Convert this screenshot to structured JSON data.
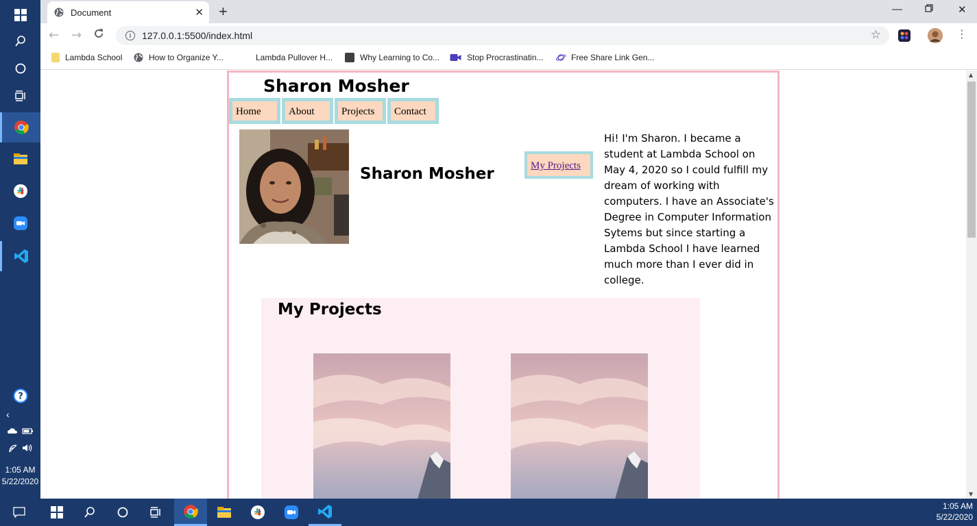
{
  "browser": {
    "tab_title": "Document",
    "new_tab": "+",
    "url": "127.0.0.1:5500/index.html",
    "bookmarks": [
      {
        "label": "Lambda School",
        "color": "#f7d774"
      },
      {
        "label": "How to Organize Y...",
        "color": "#5f6368"
      },
      {
        "label": "Lambda Pullover H...",
        "color": "#ffffff"
      },
      {
        "label": "Why Learning to Co...",
        "color": "#3c4043"
      },
      {
        "label": "Stop Procrastinatin...",
        "color": "#4a3fb8"
      },
      {
        "label": "Free Share Link Gen...",
        "color": "#6a5acd"
      }
    ]
  },
  "site": {
    "title": "Sharon Mosher",
    "nav": [
      "Home",
      "About",
      "Projects",
      "Contact"
    ],
    "hero_name": "Sharon Mosher",
    "projects_link": "My Projects",
    "bio": "Hi! I'm Sharon. I became a student at Lambda School on May 4, 2020 so I could fulfill my dream of working with computers. I have an Associate's Degree in Computer Information Sytems but since starting a Lambda School I have learned much more than I ever did in college.",
    "projects_heading": "My Projects"
  },
  "system": {
    "sidebar_time": "1:05 AM",
    "sidebar_date": "5/22/2020",
    "taskbar_time": "1:05 AM",
    "taskbar_date": "5/22/2020"
  },
  "colors": {
    "page_border": "#f4b6c2",
    "nav_bg": "#fbd8bf",
    "nav_border": "#a8dbe0",
    "projects_bg": "#fdeef3",
    "taskbar": "#1b3a6b"
  }
}
